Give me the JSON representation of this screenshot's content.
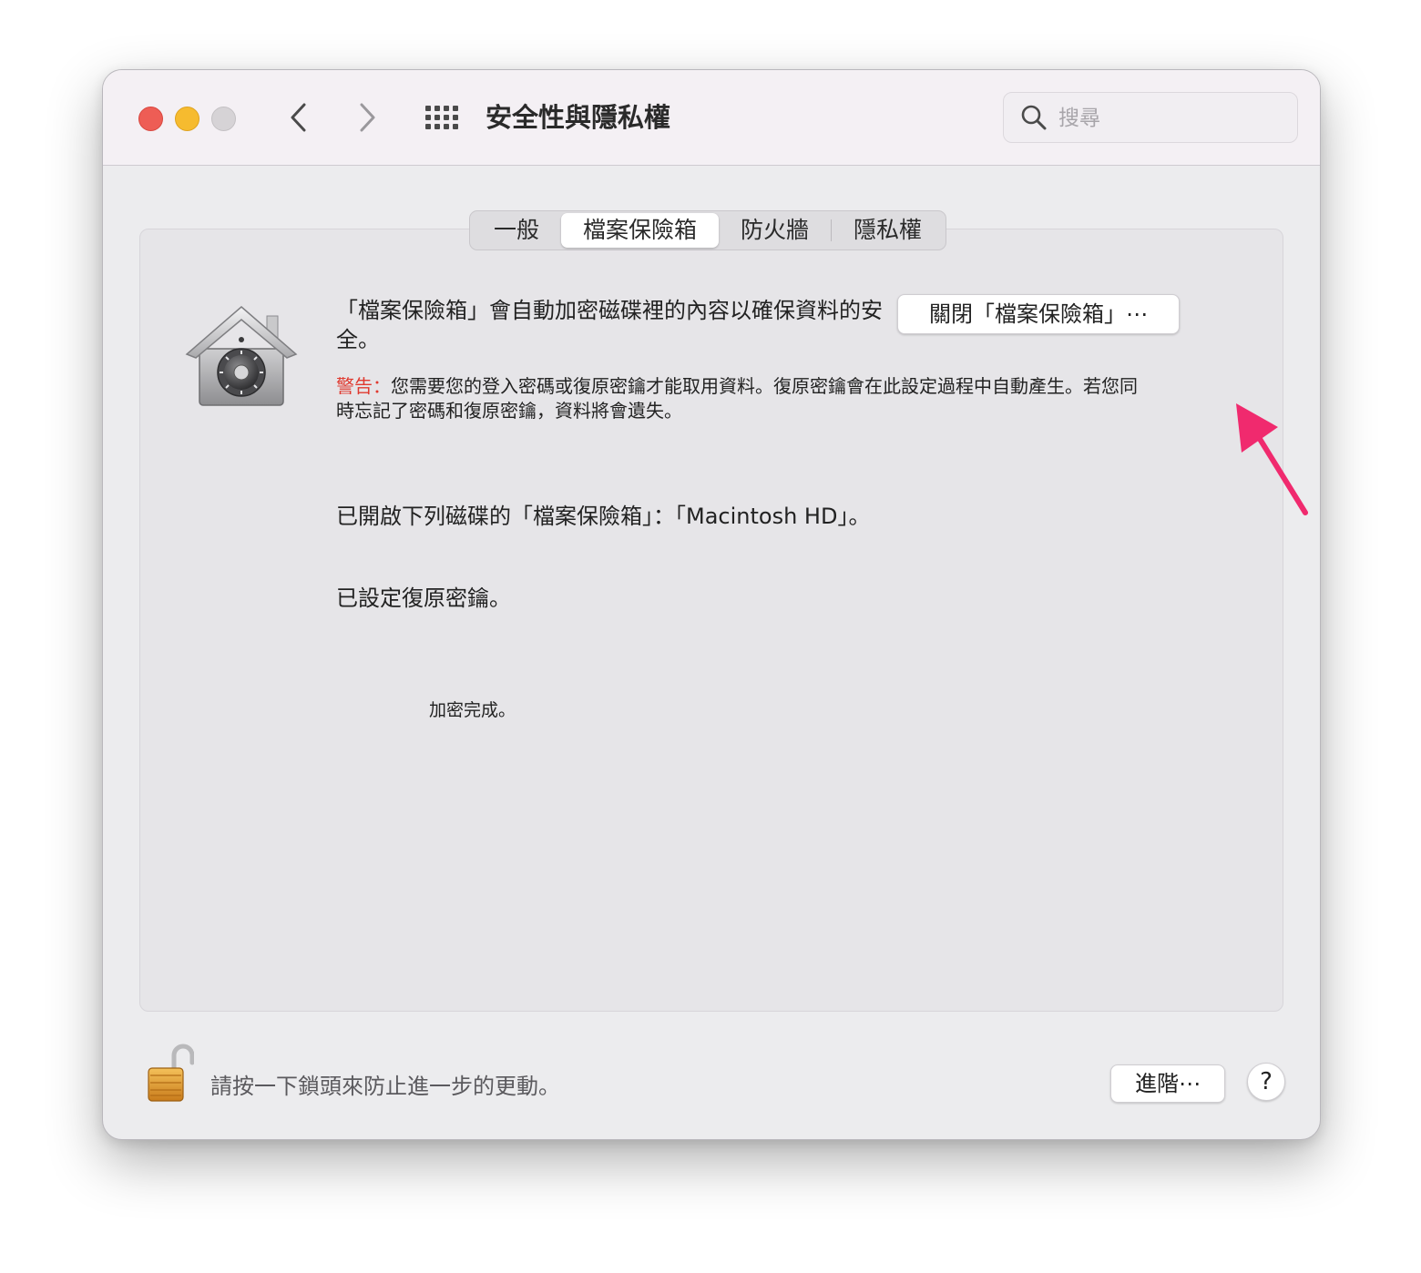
{
  "window": {
    "title": "安全性與隱私權",
    "search_placeholder": "搜尋"
  },
  "tabs": [
    {
      "label": "一般",
      "selected": false
    },
    {
      "label": "檔案保險箱",
      "selected": true
    },
    {
      "label": "防火牆",
      "selected": false
    },
    {
      "label": "隱私權",
      "selected": false
    }
  ],
  "filevault": {
    "description": "「檔案保險箱」會自動加密磁碟裡的內容以確保資料的安全。",
    "turn_off_button": "關閉「檔案保險箱」⋯",
    "warning_label": "警告：",
    "warning_text": "您需要您的登入密碼或復原密鑰才能取用資料。復原密鑰會在此設定過程中自動產生。若您同時忘記了密碼和復原密鑰，資料將會遺失。",
    "status_enabled": "已開啟下列磁碟的「檔案保險箱」：「Macintosh HD」。",
    "status_recovery_key": "已設定復原密鑰。",
    "encryption_status": "加密完成。"
  },
  "footer": {
    "lock_text": "請按一下鎖頭來防止進一步的更動。",
    "advanced_button": "進階⋯",
    "help_button": "?"
  },
  "colors": {
    "warning": "#e0392f",
    "annotation_arrow": "#f02a6e",
    "close": "#ee5d55",
    "minimize": "#f6bb2f",
    "zoom": "#d6d3d6"
  }
}
